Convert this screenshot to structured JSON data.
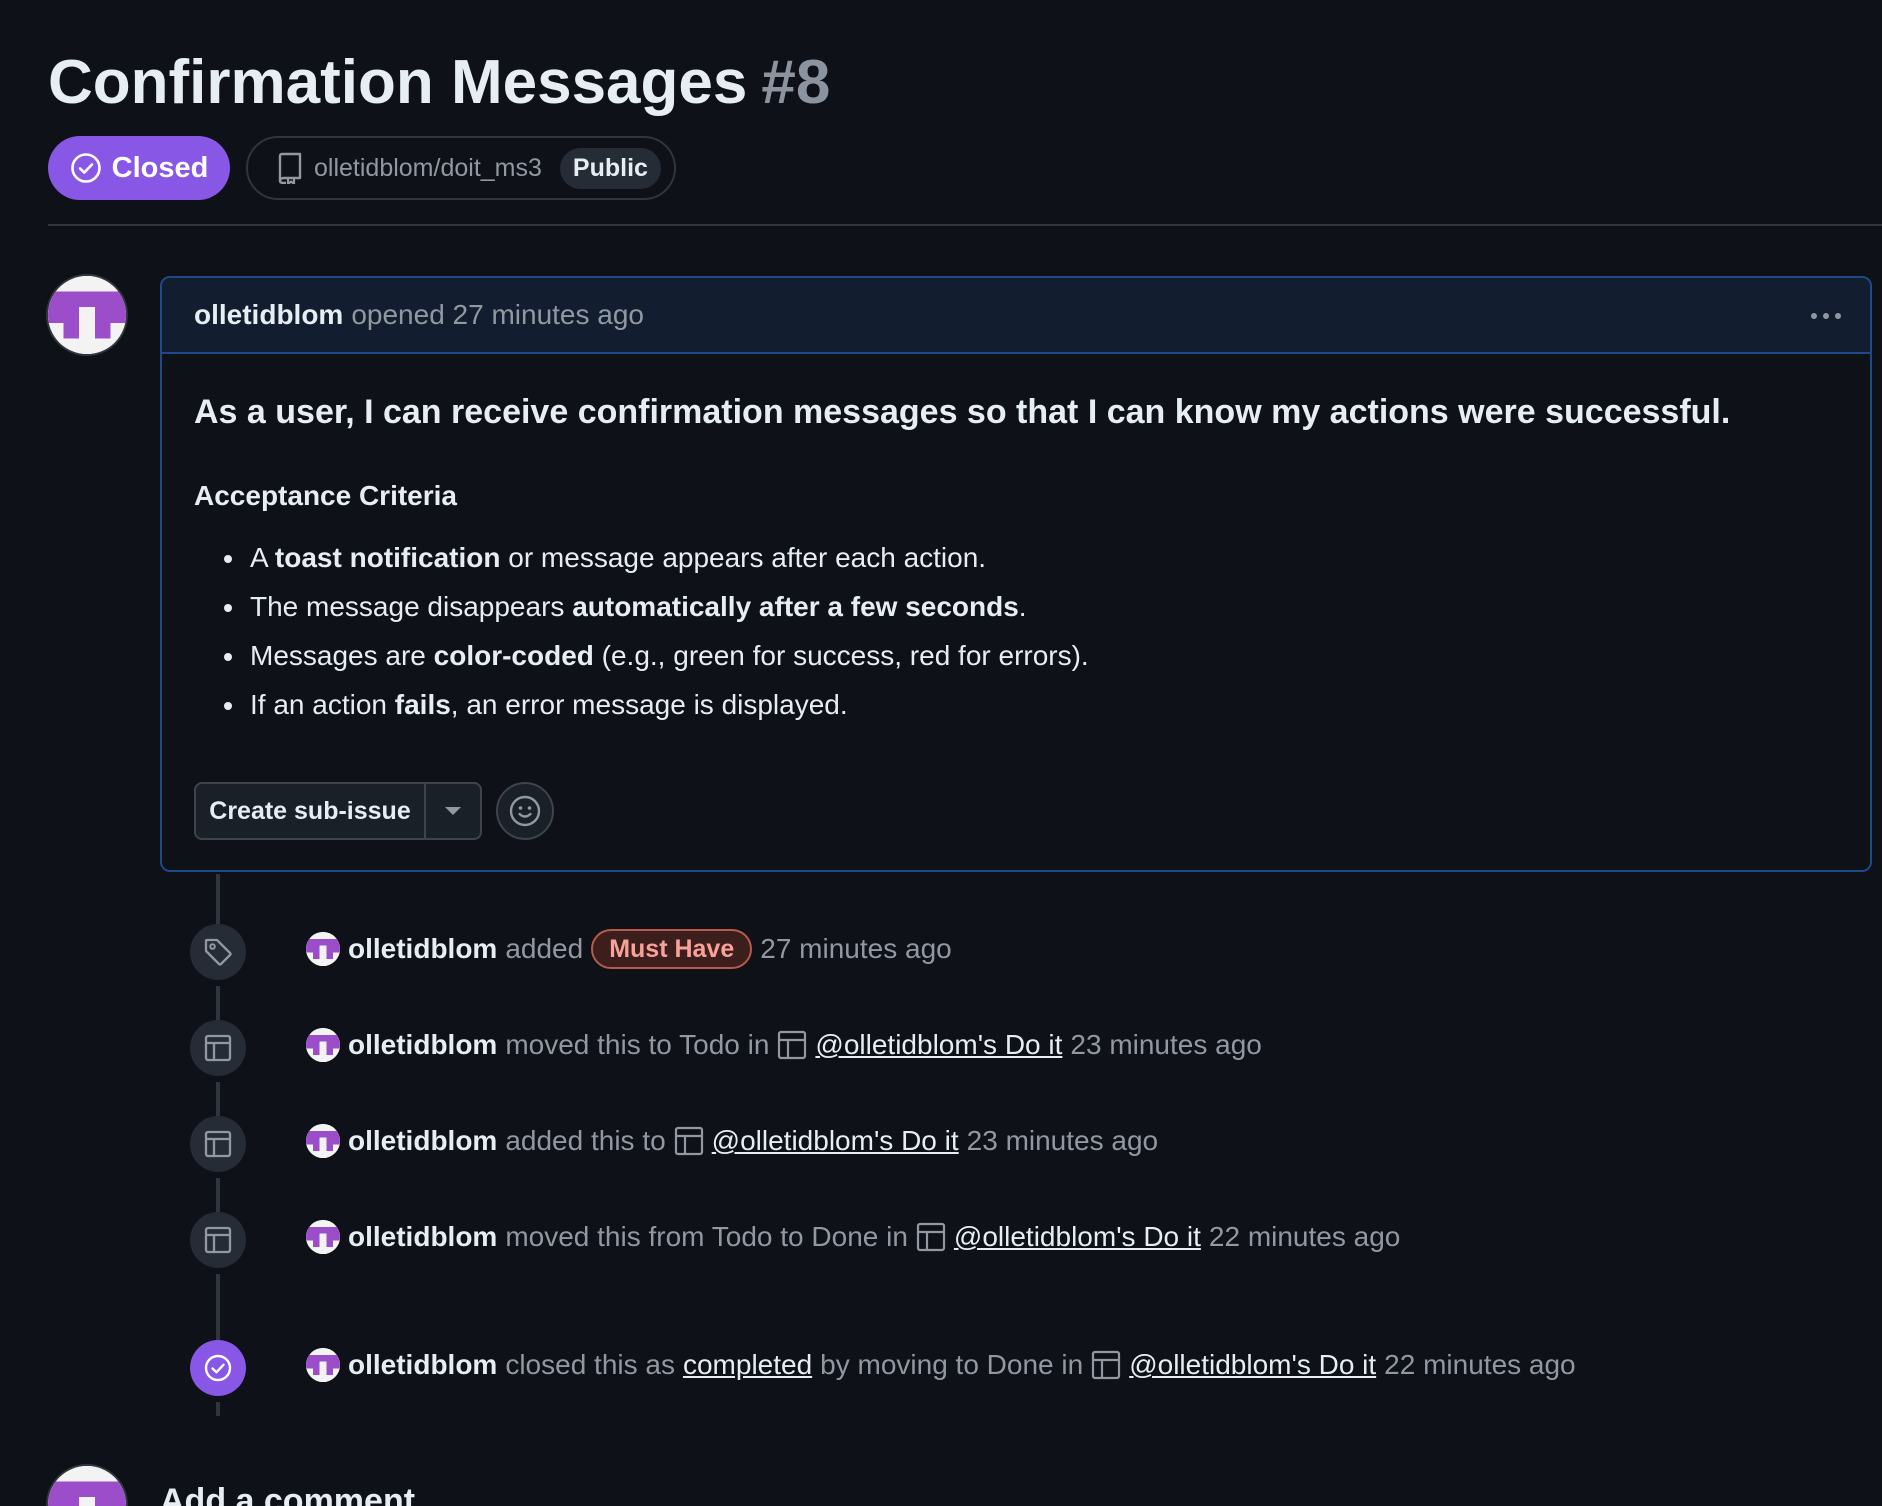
{
  "issue": {
    "title": "Confirmation Messages",
    "number": "#8",
    "state": "Closed",
    "repo": "olletidblom/doit_ms3",
    "visibility": "Public"
  },
  "comment": {
    "author": "olletidblom",
    "meta": "opened 27 minutes ago",
    "heading": "As a user, I can receive confirmation messages so that I can know my actions were successful.",
    "subheading": "Acceptance Criteria",
    "criteria": [
      [
        "A ",
        "toast notification",
        " or message appears after each action."
      ],
      [
        "The message disappears ",
        "automatically after a few seconds",
        "."
      ],
      [
        "Messages are ",
        "color-coded",
        " (e.g., green for success, red for errors)."
      ],
      [
        "If an action ",
        "fails",
        ", an error message is displayed."
      ]
    ],
    "create_sub_issue_label": "Create sub-issue"
  },
  "timeline": {
    "event1": {
      "author": "olletidblom",
      "action": "added",
      "label": "Must Have",
      "time": "27 minutes ago",
      "icon": "tag-icon"
    },
    "event2": {
      "author": "olletidblom",
      "action": "moved this to Todo in",
      "project": "@olletidblom's Do it",
      "time": "23 minutes ago",
      "icon": "project-table-icon"
    },
    "event3": {
      "author": "olletidblom",
      "action": "added this to",
      "project": "@olletidblom's Do it",
      "time": "23 minutes ago",
      "icon": "project-table-icon"
    },
    "event4": {
      "author": "olletidblom",
      "action": "moved this from Todo to Done in",
      "project": "@olletidblom's Do it",
      "time": "22 minutes ago",
      "icon": "project-table-icon"
    },
    "event5": {
      "author": "olletidblom",
      "action": "closed this as",
      "reason": "completed",
      "action2": "by moving to Done in",
      "project": "@olletidblom's Do it",
      "time": "22 minutes ago",
      "icon": "check-circle-icon"
    }
  },
  "add_comment": {
    "title": "Add a comment"
  },
  "colors": {
    "background": "#0e1117",
    "closed_purple": "#8957e5",
    "label_must_have": "#f7a199",
    "comment_border": "#1f4a8a"
  }
}
